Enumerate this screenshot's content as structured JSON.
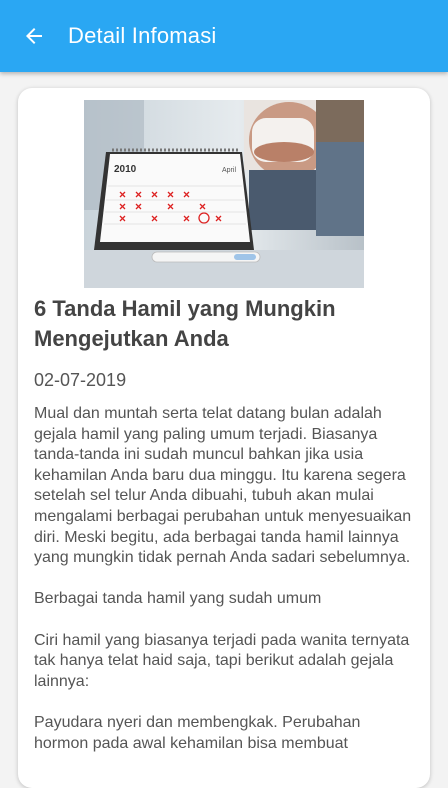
{
  "appbar": {
    "title": "Detail Infomasi",
    "back_icon": "arrow-left-icon",
    "color": "#2aa7f3"
  },
  "article": {
    "image_alt": "calendar-pregnancy-test-photo",
    "calendar_year": "2010",
    "calendar_month": "April",
    "title": "6 Tanda Hamil yang Mungkin Mengejutkan Anda",
    "date": "02-07-2019",
    "paragraphs": [
      "Mual dan muntah serta telat datang bulan adalah gejala hamil yang paling umum terjadi. Biasanya tanda-tanda ini sudah muncul bahkan jika usia kehamilan Anda baru dua minggu. Itu karena segera setelah sel telur Anda dibuahi, tubuh akan mulai mengalami berbagai perubahan untuk menyesuaikan diri. Meski begitu, ada berbagai tanda hamil lainnya yang mungkin tidak pernah Anda sadari sebelumnya.",
      "Berbagai tanda hamil yang sudah umum",
      "Ciri hamil yang biasanya terjadi pada wanita ternyata tak hanya telat haid saja, tapi berikut adalah gejala lainnya:",
      "Payudara nyeri dan membengkak. Perubahan hormon pada awal kehamilan bisa membuat"
    ]
  }
}
